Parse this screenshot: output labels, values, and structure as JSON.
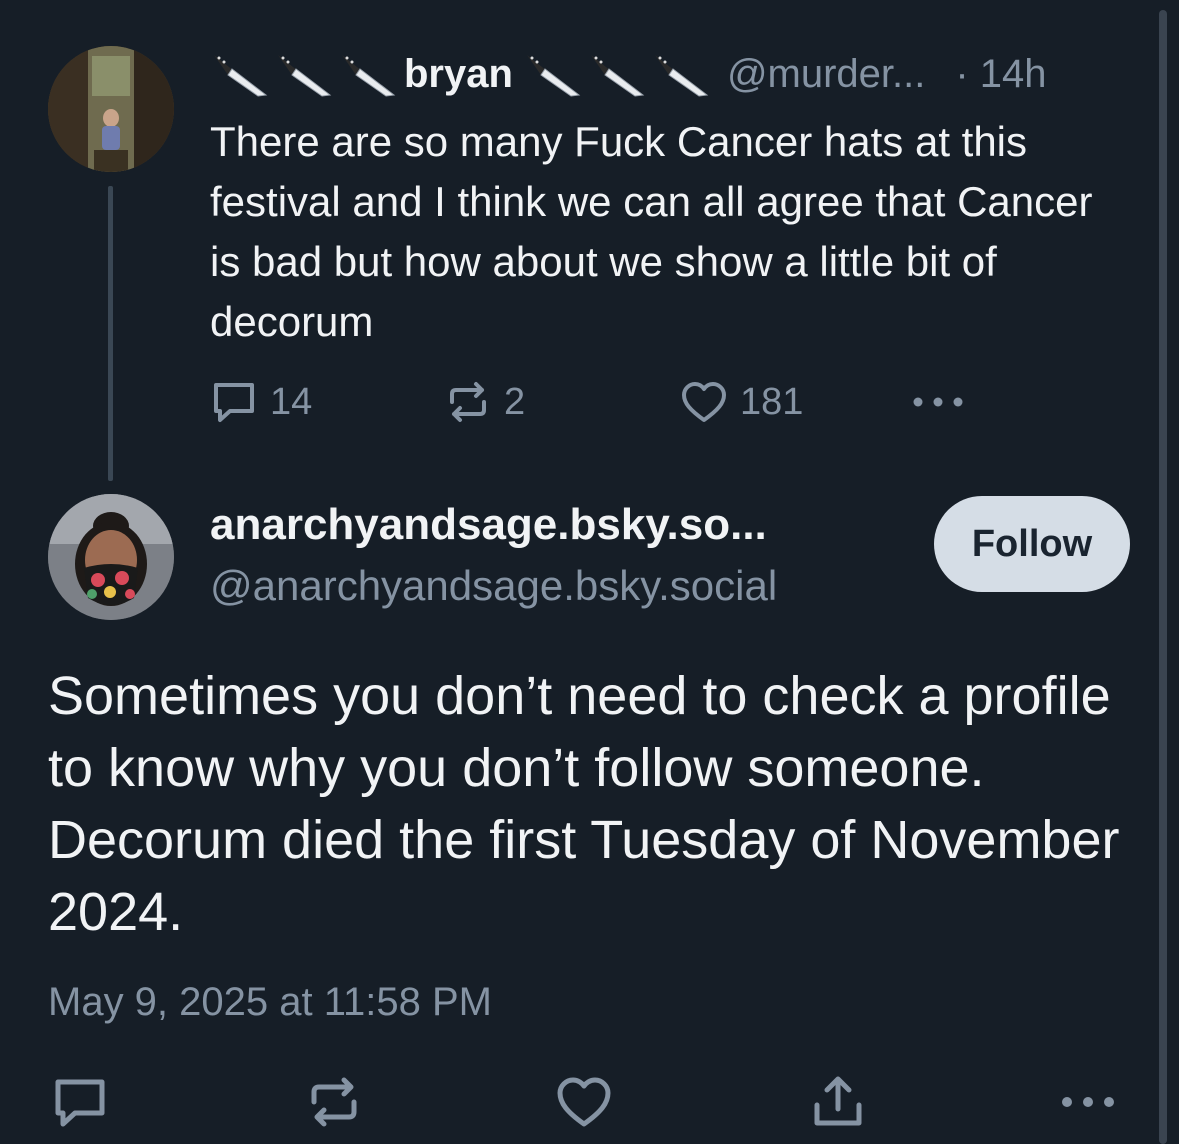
{
  "parent_post": {
    "author_name": "bryan",
    "author_handle": "@murder...",
    "time": "· 14h",
    "text": "There are so many Fuck Cancer hats at this festival and I think we can all agree that Cancer is bad but how about we show a little bit of decorum",
    "reply_count": "14",
    "repost_count": "2",
    "like_count": "181"
  },
  "main_post": {
    "display_name": "anarchyandsage.bsky.so...",
    "handle": "@anarchyandsage.bsky.social",
    "follow_label": "Follow",
    "text": "Sometimes you don’t need to check a profile to know why you don’t follow someone. Decorum died the first Tuesday of November 2024.",
    "timestamp": "May 9, 2025 at 11:58 PM"
  },
  "colors": {
    "background": "#161e27",
    "text": "#f1f3f5",
    "muted": "#8593a3",
    "follow_button": "#d5dde6"
  },
  "icons": {
    "name_decoration": "kitchen-knife-emoji",
    "reply": "speech-bubble-icon",
    "repost": "repost-arrows-icon",
    "like": "heart-icon",
    "share": "share-upload-icon",
    "more": "ellipsis-icon"
  }
}
